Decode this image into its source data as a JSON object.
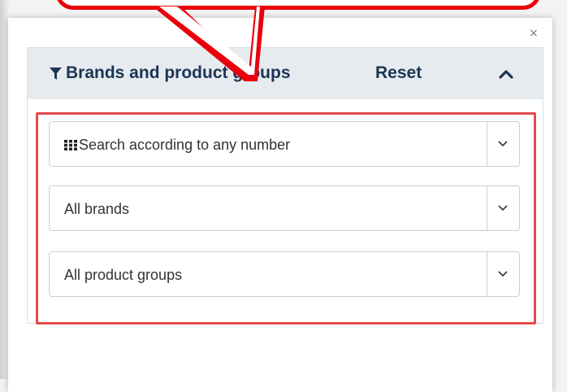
{
  "panel": {
    "close_symbol": "×",
    "header": {
      "filter_icon": "filter-funnel",
      "title": "Brands and product groups",
      "reset_label": "Reset",
      "collapse_icon": "chevron-up"
    },
    "selects": [
      {
        "icon": "barcode-grid",
        "value": "Search according to any number"
      },
      {
        "value": "All brands"
      },
      {
        "value": "All product groups"
      }
    ]
  },
  "annotation": {
    "highlight_color": "#e24b4b",
    "callout_color": "#e8000b"
  }
}
